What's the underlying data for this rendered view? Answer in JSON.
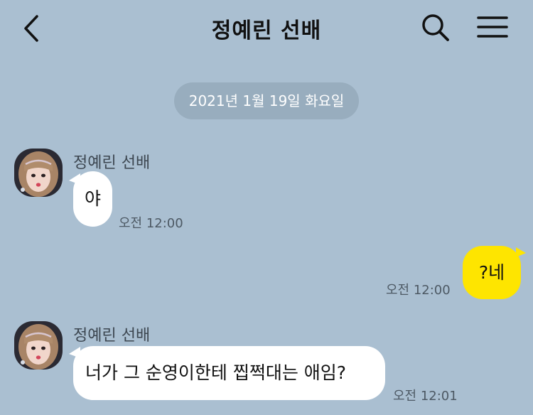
{
  "header": {
    "title": "정예린 선배"
  },
  "date_divider": "2021년 1월 19일 화요일",
  "messages": [
    {
      "direction": "incoming",
      "sender": "정예린 선배",
      "text": "야",
      "time": "오전 12:00"
    },
    {
      "direction": "outgoing",
      "text": "?네",
      "time": "오전 12:00"
    },
    {
      "direction": "incoming",
      "sender": "정예린 선배",
      "text": "너가 그 순영이한테 찝쩍대는 애임?",
      "time": "오전 12:01"
    }
  ],
  "colors": {
    "background": "#aabfd1",
    "incoming_bubble": "#ffffff",
    "outgoing_bubble": "#fee500",
    "date_pill": "#98adbe"
  },
  "icons": {
    "back": "chevron-left-icon",
    "search": "search-icon",
    "menu": "hamburger-menu-icon"
  }
}
